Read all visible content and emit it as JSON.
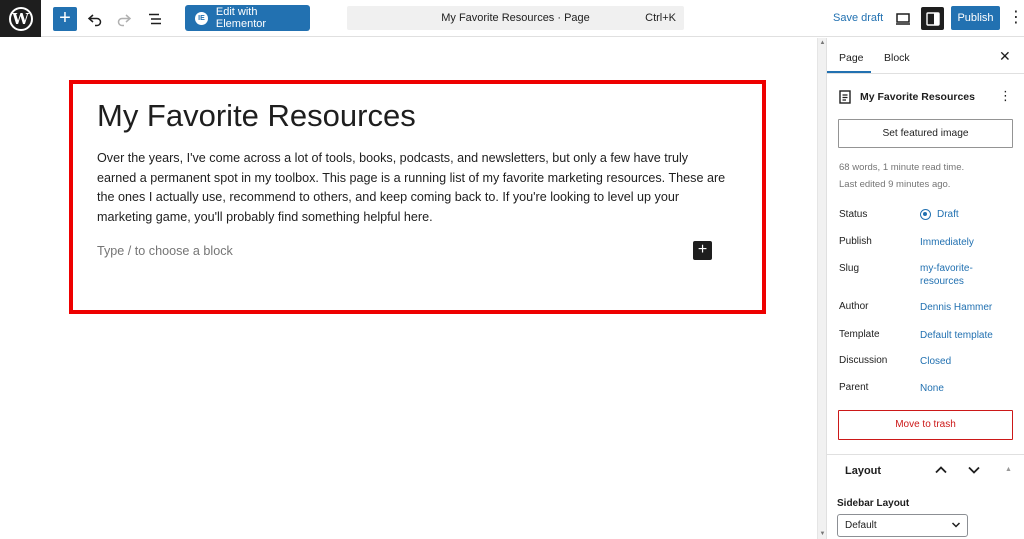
{
  "header": {
    "elementor_label": "Edit with Elementor",
    "elementor_badge": "IE",
    "command_title": "My Favorite Resources · Page",
    "command_shortcut": "Ctrl+K",
    "save_draft": "Save draft",
    "publish": "Publish",
    "wp_logo": "W",
    "add_glyph": "+",
    "more_glyph": "⋮"
  },
  "editor": {
    "title": "My Favorite Resources",
    "body": "Over the years, I've come across a lot of tools, books, podcasts, and newsletters, but only a few have truly earned a permanent spot in my toolbox. This page is a running list of my favorite marketing resources. These are the ones I actually use, recommend to others, and keep coming back to. If you're looking to level up your marketing game, you'll probably find something helpful here.",
    "placeholder": "Type / to choose a block",
    "inserter_glyph": "+"
  },
  "sidebar": {
    "tabs": [
      {
        "label": "Page"
      },
      {
        "label": "Block"
      }
    ],
    "close_glyph": "✕",
    "doc_title": "My Favorite Resources",
    "doc_more": "⋮",
    "featured_image": "Set featured image",
    "words": "68 words, 1 minute read time.",
    "last_edited": "Last edited 9 minutes ago.",
    "props": [
      {
        "label": "Status",
        "value": "Draft"
      },
      {
        "label": "Publish",
        "value": "Immediately"
      },
      {
        "label": "Slug",
        "value": "my-favorite-resources"
      },
      {
        "label": "Author",
        "value": "Dennis Hammer"
      },
      {
        "label": "Template",
        "value": "Default template"
      },
      {
        "label": "Discussion",
        "value": "Closed"
      },
      {
        "label": "Parent",
        "value": "None"
      }
    ],
    "trash": "Move to trash",
    "layout_title": "Layout",
    "sidebar_layout_label": "Sidebar Layout",
    "sidebar_layout_value": "Default"
  },
  "colors": {
    "accent": "#2271b1",
    "highlight": "#ee0000",
    "danger": "#cc1818"
  }
}
